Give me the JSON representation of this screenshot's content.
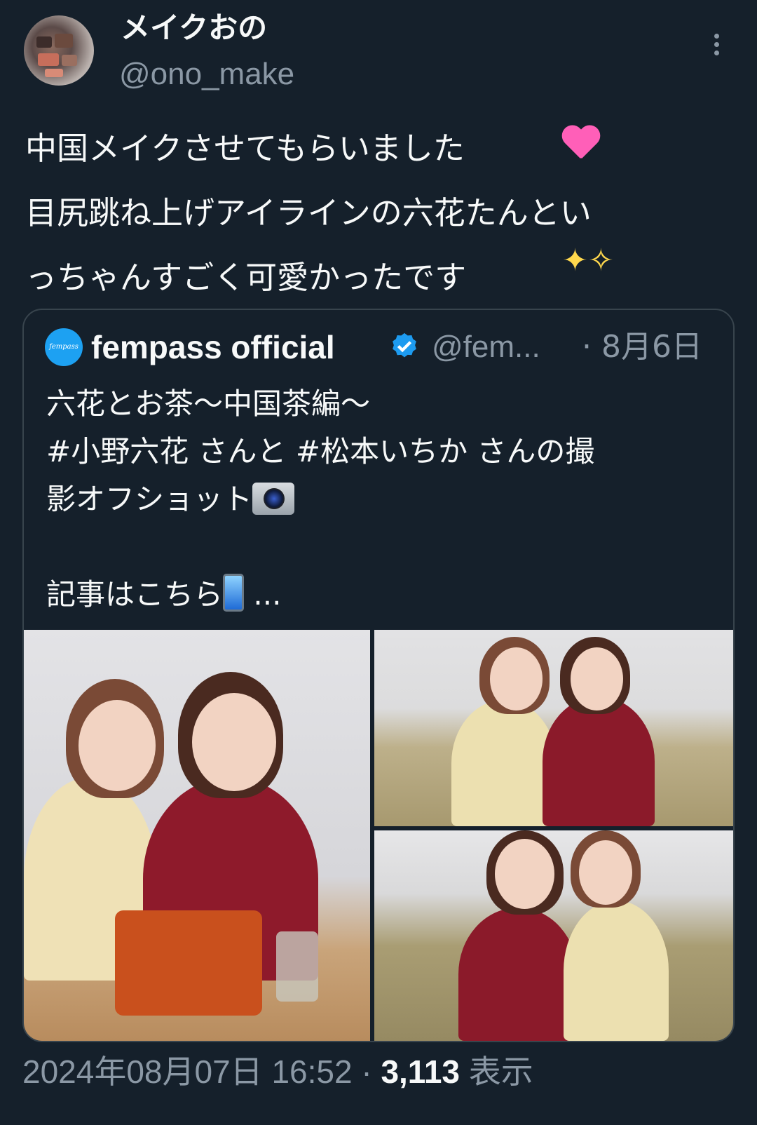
{
  "author": {
    "name": "メイクおの",
    "handle": "@ono_make"
  },
  "tweet": {
    "text": "中国メイクさせてもらいました\n目尻跳ね上げアイラインの六花たんとい\nっちゃんすごく可愛かったです"
  },
  "quoted": {
    "name": "fempass official",
    "handle": "@fem...",
    "date": "· 8月6日",
    "logo_text": "fempass",
    "text_line1": "六花とお茶〜中国茶編〜\n#小野六花 さんと #松本いちか さんの撮\n影オフショット",
    "text_line2": "記事はこちら",
    "ellipsis": " ...",
    "images": [
      "photo-1",
      "photo-2",
      "photo-3"
    ]
  },
  "meta": {
    "timestamp": "2024年08月07日 16:52 · ",
    "views": "3,113",
    "views_label": " 表示"
  },
  "colors": {
    "background": "#15202b",
    "text": "#f7f9f9",
    "muted": "#8b98a5",
    "border": "#38444d",
    "verified": "#1d9bf0"
  },
  "icons": [
    "more-icon",
    "heart-emoji-icon",
    "sparkles-emoji-icon",
    "verified-icon",
    "camera-emoji-icon",
    "phone-emoji-icon"
  ]
}
